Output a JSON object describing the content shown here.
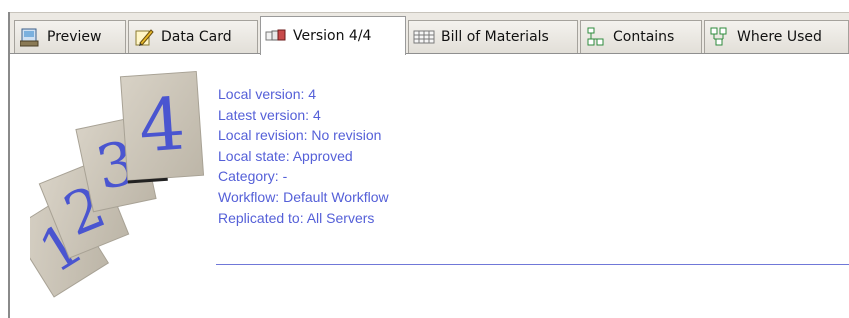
{
  "tabs": [
    {
      "label": "Preview",
      "icon": "preview-icon",
      "active": false
    },
    {
      "label": "Data Card",
      "icon": "pencil-icon",
      "active": false
    },
    {
      "label": "Version 4/4",
      "icon": "version-icon",
      "active": true
    },
    {
      "label": "Bill of Materials",
      "icon": "table-icon",
      "active": false
    },
    {
      "label": "Contains",
      "icon": "tree-icon",
      "active": false
    },
    {
      "label": "Where Used",
      "icon": "where-used-icon",
      "active": false
    }
  ],
  "version_info": {
    "local_version": "Local version: 4",
    "latest_version": "Latest version: 4",
    "local_revision": "Local revision: No revision",
    "local_state": "Local state: Approved",
    "category": "Category: -",
    "workflow": "Workflow: Default Workflow",
    "replicated_to": "Replicated to: All Servers"
  },
  "cards": [
    "1",
    "2",
    "3",
    "4"
  ],
  "colors": {
    "accent_text": "#5560d8",
    "card": "#cdc7bb",
    "tabbar": "#ece9e3"
  }
}
